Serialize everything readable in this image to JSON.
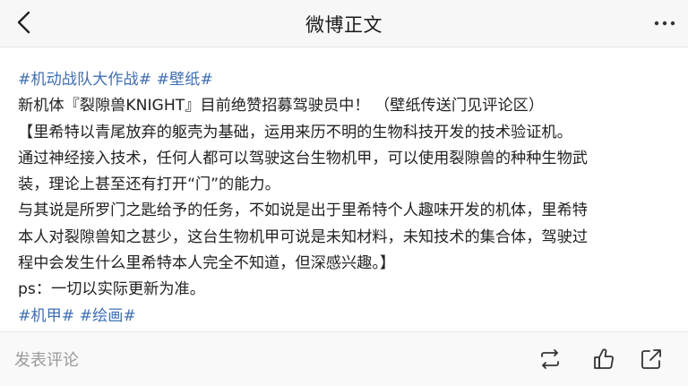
{
  "header": {
    "title": "微博正文",
    "back_icon": "chevron-left-icon",
    "more_icon": "more-dots-icon"
  },
  "post": {
    "tags_top": [
      "#机动战队大作战#",
      "#壁纸#"
    ],
    "lines": [
      "新机体『裂隙兽KNIGHT』目前绝赞招募驾驶员中！ （壁纸传送门见评论区）",
      "【里希特以青尾放弃的躯壳为基础，运用来历不明的生物科技开发的技术验证机。",
      "通过神经接入技术，任何人都可以驾驶这台生物机甲，可以使用裂隙兽的种种生物武",
      "装，理论上甚至还有打开“门”的能力。",
      "与其说是所罗门之匙给予的任务，不如说是出于里希特个人趣味开发的机体，里希特",
      "本人对裂隙兽知之甚少，这台生物机甲可说是未知材料，未知技术的集合体，驾驶过",
      "程中会发生什么里希特本人完全不知道，但深感兴趣。】",
      "ps：一切以实际更新为准。"
    ],
    "tags_bottom": [
      "#机甲#",
      "#绘画#"
    ],
    "tag_color": "#3f6fb3"
  },
  "footer": {
    "comment_placeholder": "发表评论",
    "repost_icon": "repost-icon",
    "like_icon": "thumbs-up-icon",
    "share_icon": "share-icon"
  }
}
